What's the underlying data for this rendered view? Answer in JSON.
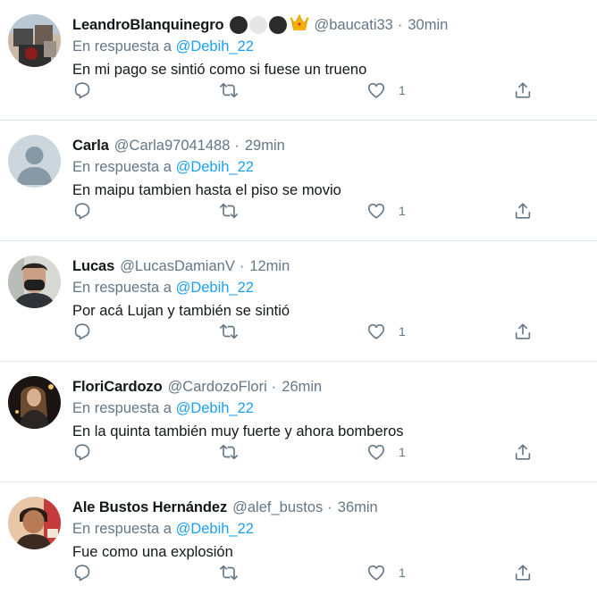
{
  "reply_prefix": "En respuesta a",
  "colors": {
    "text": "#14171a",
    "secondary": "#657786",
    "link": "#1da1f2",
    "divider": "#e1e8ed"
  },
  "tweets": [
    {
      "name": "LeandroBlanquinegro",
      "badges": [
        "black-circle-icon",
        "white-circle-icon",
        "black-circle-icon",
        "crown-icon"
      ],
      "handle": "@baucati33",
      "separator": "·",
      "time": "30min",
      "mention": "@Debih_22",
      "text": "En mi pago se sintió como si fuese un trueno",
      "like_count": "1"
    },
    {
      "name": "Carla",
      "handle": "@Carla97041488",
      "separator": "·",
      "time": "29min",
      "mention": "@Debih_22",
      "text": "En maipu tambien hasta el piso se movio",
      "like_count": "1"
    },
    {
      "name": "Lucas",
      "handle": "@LucasDamianV",
      "separator": "·",
      "time": "12min",
      "mention": "@Debih_22",
      "text": "Por acá Lujan y también se sintió",
      "like_count": "1"
    },
    {
      "name": "FloriCardozo",
      "handle": "@CardozoFlori",
      "separator": "·",
      "time": "26min",
      "mention": "@Debih_22",
      "text": "En la quinta también muy fuerte y ahora bomberos",
      "like_count": "1"
    },
    {
      "name": "Ale Bustos Hernández",
      "handle": "@alef_bustos",
      "separator": "·",
      "time": "36min",
      "mention": "@Debih_22",
      "text": "Fue como una explosión",
      "like_count": "1"
    }
  ]
}
